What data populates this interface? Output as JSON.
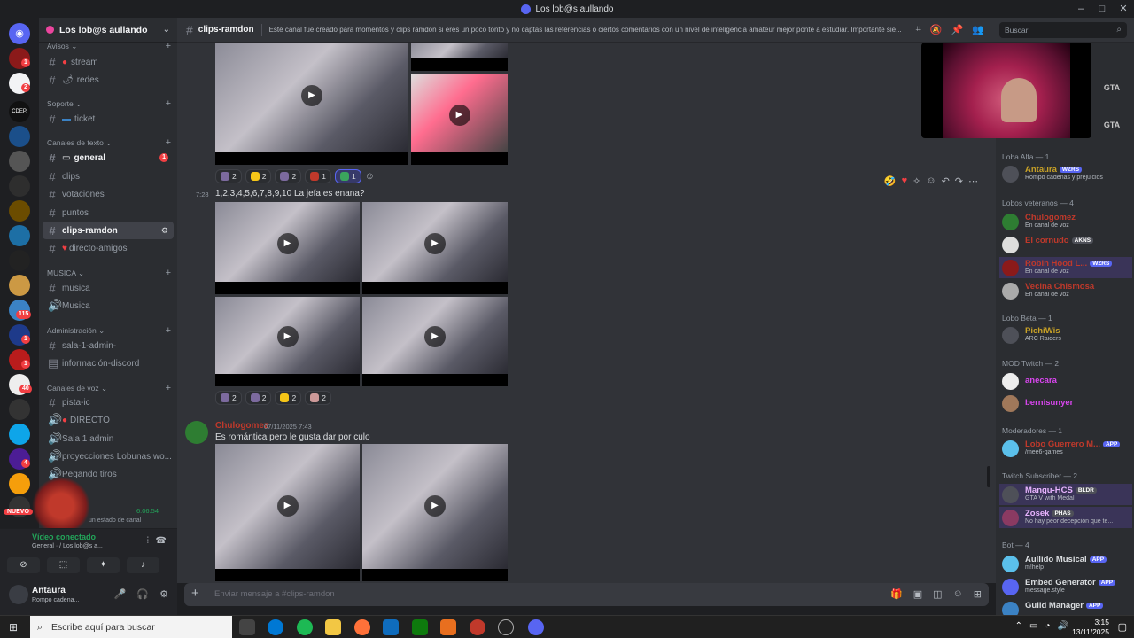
{
  "window": {
    "title": "Los lob@s aullando"
  },
  "server": {
    "name": "Los lob@s aullando"
  },
  "rail": {
    "badges": [
      "1",
      "2",
      "115",
      "1",
      "1",
      "40",
      "4"
    ],
    "labels": [
      "CDEP.",
      "NUEVO"
    ]
  },
  "channels": {
    "cat_avisos": "Avisos",
    "avisos": [
      {
        "name": "stream"
      },
      {
        "name": "redes"
      }
    ],
    "cat_soporte": "Soporte",
    "soporte": [
      {
        "name": "ticket"
      }
    ],
    "cat_texto": "Canales de texto",
    "texto": [
      {
        "name": "general",
        "mention": "1"
      },
      {
        "name": "clips"
      },
      {
        "name": "votaciones"
      },
      {
        "name": "puntos"
      },
      {
        "name": "clips-ramdon"
      },
      {
        "name": "directo-amigos"
      }
    ],
    "cat_musica": "MUSICA",
    "musica": [
      {
        "name": "musica"
      },
      {
        "name": "Musica"
      }
    ],
    "cat_admin": "Administración",
    "admin": [
      {
        "name": "sala-1-admin-"
      },
      {
        "name": "información-discord"
      }
    ],
    "cat_voz": "Canales de voz",
    "voz": [
      {
        "name": "pista-ic"
      },
      {
        "name": "DIRECTO"
      },
      {
        "name": "Sala 1 admin"
      },
      {
        "name": "proyecciones Lobunas wo..."
      },
      {
        "name": "Pegando tiros"
      }
    ]
  },
  "voice": {
    "status": "Vídeo conectado",
    "channel": "General · / Los lob@s a...",
    "timer": "6:06:54",
    "custom_status": "un estado de canal"
  },
  "user": {
    "name": "Antaura",
    "status": "Rompo cadena..."
  },
  "header": {
    "channel": "clips-ramdon",
    "topic": "Esté canal fue creado para momentos y clips ramdon si eres un poco tonto y no captas las referencias o ciertos comentarios con un nivel de inteligencia amateur mejor ponte a estudiar. Importante sie..."
  },
  "search": {
    "placeholder": "Buscar"
  },
  "messages": {
    "r1": [
      "2",
      "2",
      "2",
      "1",
      "1"
    ],
    "m2_time": "7:28",
    "m2_text": "1,2,3,4,5,6,7,8,9,10 La jefa es enana?",
    "r2": [
      "2",
      "2",
      "2",
      "2"
    ],
    "m3_author": "Chulogomez",
    "m3_date": "07/11/2025 7:43",
    "m3_text": "Es romántica pero le gusta dar por culo"
  },
  "composer": {
    "placeholder": "Enviar mensaje a #clips-ramdon"
  },
  "members": {
    "g1": "Loba Alfa — 1",
    "g2": "Lobos veteranos — 4",
    "g3": "Lobo Beta — 1",
    "g4": "MOD Twitch — 2",
    "g5": "Moderadores — 1",
    "g6": "Twitch Subscriber — 2",
    "g7": "Bot — 4",
    "list": [
      {
        "name": "Antaura",
        "tag": "WZRS",
        "status": "Rompo cadenas y prejuicios",
        "color": "#c9a227"
      },
      {
        "name": "Chulogomez",
        "status": "En canal de voz",
        "color": "#c0392b"
      },
      {
        "name": "El cornudo",
        "tag": "AKNS",
        "status": "",
        "color": "#c0392b"
      },
      {
        "name": "Robin Hood L...",
        "tag": "WZRS",
        "status": "En canal de voz",
        "color": "#c0392b"
      },
      {
        "name": "Vecina Chismosa",
        "status": "En canal de voz",
        "color": "#c0392b"
      },
      {
        "name": "PichiWis",
        "status": "ARC Raiders",
        "color": "#c9a227"
      },
      {
        "name": "anecara",
        "status": "",
        "color": "#d946ef"
      },
      {
        "name": "bernisunyer",
        "status": "",
        "color": "#d946ef"
      },
      {
        "name": "Lobo Guerrero M...",
        "tag": "APP",
        "status": "/mee6-games",
        "color": "#c0392b"
      },
      {
        "name": "Mangu-HCS",
        "tag": "BLDR",
        "status": "GTA V with Medal",
        "color": "#e8b4ff"
      },
      {
        "name": "Zosek",
        "tag": "PHAS",
        "status": "No hay peor decepción que te...",
        "color": "#e8b4ff"
      },
      {
        "name": "Aullido Musical",
        "tag": "APP",
        "status": "m!help",
        "color": "#dbdee1"
      },
      {
        "name": "Embed Generator",
        "tag": "APP",
        "status": "message.style",
        "color": "#dbdee1"
      },
      {
        "name": "Guild Manager",
        "tag": "APP",
        "status": "",
        "color": "#dbdee1"
      }
    ]
  },
  "stream": {
    "badge": "GTA"
  },
  "taskbar": {
    "search": "Escribe aquí para buscar",
    "time": "3:15",
    "date": "13/11/2025"
  }
}
